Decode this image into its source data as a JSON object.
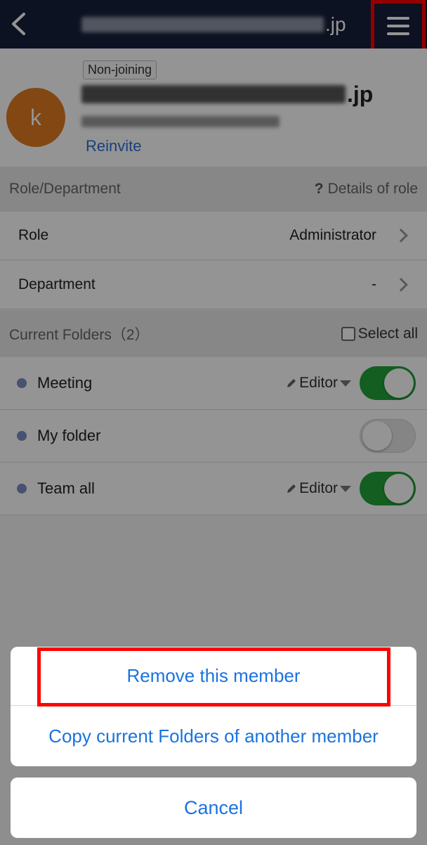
{
  "header": {
    "title_suffix": ".jp"
  },
  "profile": {
    "avatar_initial": "k",
    "status_badge": "Non-joining",
    "name_suffix": ".jp",
    "reinvite_label": "Reinvite"
  },
  "role_section": {
    "title": "Role/Department",
    "help_icon": "?",
    "help_label": "Details of role",
    "rows": [
      {
        "label": "Role",
        "value": "Administrator"
      },
      {
        "label": "Department",
        "value": "-"
      }
    ]
  },
  "folders_section": {
    "title": "Current Folders（2）",
    "select_all_label": "Select all",
    "items": [
      {
        "name": "Meeting",
        "permission": "Editor",
        "enabled": true
      },
      {
        "name": "My folder",
        "permission": "",
        "enabled": false
      },
      {
        "name": "Team all",
        "permission": "Editor",
        "enabled": true
      }
    ]
  },
  "action_sheet": {
    "remove_label": "Remove this member",
    "copy_label": "Copy current Folders of another member",
    "cancel_label": "Cancel"
  },
  "colors": {
    "header_bg": "#162039",
    "avatar_bg": "#e07a1f",
    "link_blue": "#1a73e0",
    "toggle_on": "#21a338",
    "highlight": "#ff0000"
  }
}
